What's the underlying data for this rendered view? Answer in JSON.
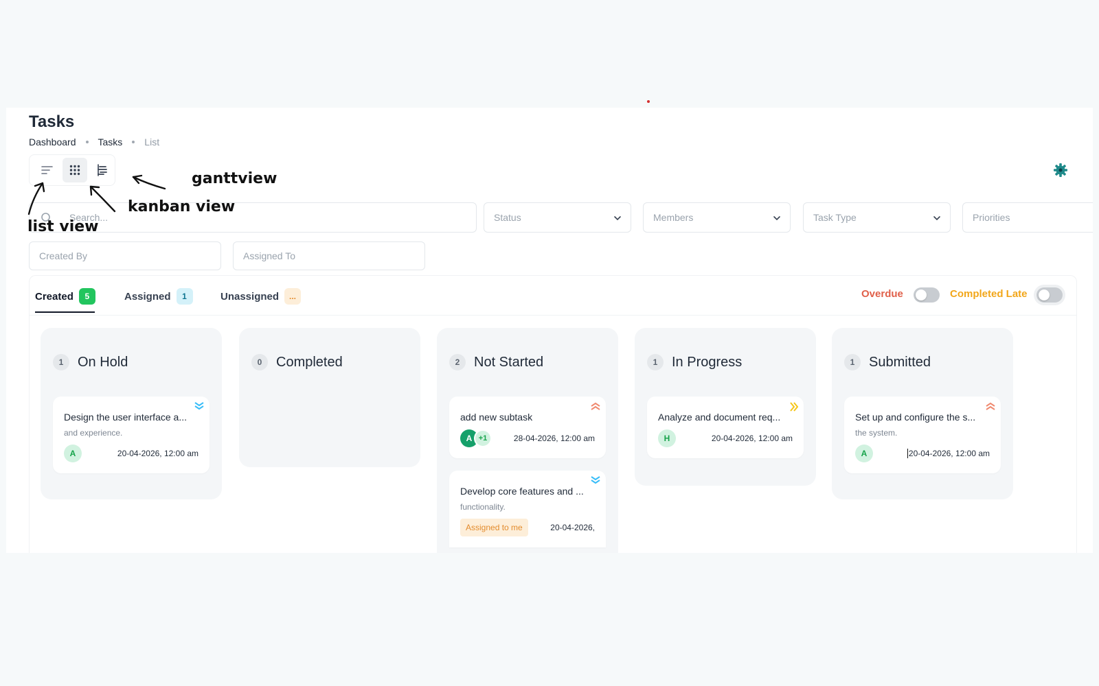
{
  "header": {
    "title": "Tasks",
    "breadcrumb": [
      "Dashboard",
      "Tasks",
      "List"
    ]
  },
  "view_switch": {
    "active": "kanban",
    "icons": [
      "list-icon",
      "grid-icon",
      "gantt-icon"
    ]
  },
  "annotations": {
    "gantt": "ganttview",
    "kanban": "kanban view",
    "list": "list view"
  },
  "filters": {
    "search_placeholder": "Search...",
    "status": "Status",
    "members": "Members",
    "task_type": "Task Type",
    "priorities": "Priorities",
    "created_by": "Created By",
    "assigned_to": "Assigned To"
  },
  "tabs": [
    {
      "label": "Created",
      "count": "5",
      "badge_bg": "#22c55e",
      "badge_fg": "#ffffff"
    },
    {
      "label": "Assigned",
      "count": "1",
      "badge_bg": "#d4f1f9",
      "badge_fg": "#0e7490"
    },
    {
      "label": "Unassigned",
      "count": "...",
      "badge_bg": "#fdeed9",
      "badge_fg": "#e38b2c"
    }
  ],
  "toggles": {
    "overdue": {
      "label": "Overdue",
      "color": "#e0604a"
    },
    "completed_late": {
      "label": "Completed Late",
      "color": "#f2a619"
    }
  },
  "columns": [
    {
      "title": "On Hold",
      "count": "1",
      "cards": [
        {
          "title": "Design the user interface a...",
          "desc": "and experience.",
          "avatar": "A",
          "date": "20-04-2026, 12:00 am",
          "priority": "low"
        }
      ]
    },
    {
      "title": "Completed",
      "count": "0",
      "cards": []
    },
    {
      "title": "Not Started",
      "count": "2",
      "cards": [
        {
          "title": "add new subtask",
          "avatar": "A",
          "more": "+1",
          "date": "28-04-2026, 12:00 am",
          "priority": "high"
        },
        {
          "title": "Develop core features and ...",
          "desc": "functionality.",
          "tag": "Assigned to me",
          "date": "20-04-2026,",
          "priority": "low"
        }
      ]
    },
    {
      "title": "In Progress",
      "count": "1",
      "cards": [
        {
          "title": "Analyze and document req...",
          "avatar": "H",
          "date": "20-04-2026, 12:00 am",
          "priority": "medium"
        }
      ]
    },
    {
      "title": "Submitted",
      "count": "1",
      "cards": [
        {
          "title": "Set up and configure the s...",
          "desc": "the system.",
          "avatar": "A",
          "date": "20-04-2026, 12:00 am",
          "priority": "high"
        }
      ]
    }
  ],
  "colors": {
    "accent": "#15a06a",
    "priority_low": "#38bdf8",
    "priority_medium": "#f5c518",
    "priority_high": "#f08a70"
  }
}
